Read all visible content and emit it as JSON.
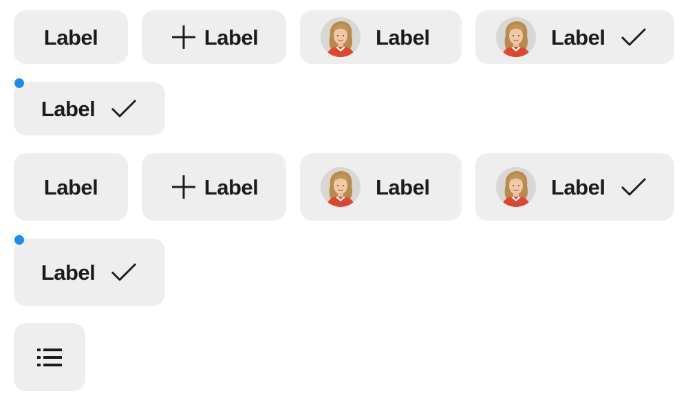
{
  "colors": {
    "chip_background": "#eeeeee",
    "text": "#1b1b1b",
    "indicator_dot": "#1a8cf0"
  },
  "group_one": {
    "chips": [
      {
        "label": "Label",
        "variant": "text-only"
      },
      {
        "label": "Label",
        "variant": "leading-icon",
        "icon": "plus-icon"
      },
      {
        "label": "Label",
        "variant": "avatar",
        "icon": "avatar"
      },
      {
        "label": "Label",
        "variant": "avatar-selected",
        "icon": "checkmark-icon"
      },
      {
        "label": "Label",
        "variant": "selected-with-dot",
        "icon": "checkmark-icon"
      }
    ]
  },
  "group_two": {
    "chips": [
      {
        "label": "Label",
        "variant": "text-only"
      },
      {
        "label": "Label",
        "variant": "leading-icon",
        "icon": "plus-icon"
      },
      {
        "label": "Label",
        "variant": "avatar",
        "icon": "avatar"
      },
      {
        "label": "Label",
        "variant": "avatar-selected",
        "icon": "checkmark-icon"
      },
      {
        "label": "Label",
        "variant": "selected-with-dot",
        "icon": "checkmark-icon"
      }
    ]
  },
  "icon_chip": {
    "icon": "list-icon"
  }
}
